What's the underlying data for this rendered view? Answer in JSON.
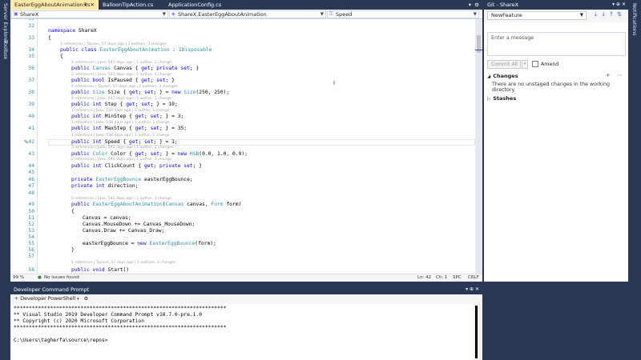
{
  "left_sidebar": [
    "Server Explorer",
    "Toolbox"
  ],
  "right_sidebar": [
    "Notifications"
  ],
  "tabs": [
    {
      "label": "EasterEggAboutAnimation.cs",
      "active": true
    },
    {
      "label": "BalloonTipAction.cs",
      "active": false
    },
    {
      "label": "ApplicationConfig.cs",
      "active": false
    }
  ],
  "navbar": {
    "project": "ShareX",
    "type": "ShareX.EasterEggAboutAnimation",
    "member": "Speed"
  },
  "code_lines": [
    {
      "num": "32",
      "text": ""
    },
    {
      "num": "33",
      "text": "{"
    },
    {
      "num": "34",
      "text": "    public class EasterEggAboutAnimation : IDisposable"
    },
    {
      "num": "35",
      "text": "    {"
    },
    {
      "num": "36",
      "text": "        public Canvas Canvas { get; private set; }"
    },
    {
      "num": "37",
      "text": "        public bool IsPaused { get; set; }"
    },
    {
      "num": "38",
      "text": "        public Size Size { get; set; } = new Size(250, 250);"
    },
    {
      "num": "39",
      "text": "        public int Step { get; set; } = 10;"
    },
    {
      "num": "40",
      "text": "        public int MinStep { get; set; } = 3;"
    },
    {
      "num": "41",
      "text": "        public int MaxStep { get; set; } = 35;"
    },
    {
      "num": "42",
      "text": "        public int Speed { get; set; } = 1;"
    },
    {
      "num": "43",
      "text": "        public Color Color { get; set; } = new HSB(0.0, 1.0, 0.9);"
    },
    {
      "num": "44",
      "text": "        public int ClickCount { get; private set; }"
    },
    {
      "num": "45",
      "text": ""
    },
    {
      "num": "46",
      "text": "        private EasterEggBounce easterEggBounce;"
    },
    {
      "num": "47",
      "text": "        private int direction;"
    },
    {
      "num": "48",
      "text": ""
    },
    {
      "num": "49",
      "text": "        public EasterEggAboutAnimation(Canvas canvas, Form form)"
    },
    {
      "num": "50",
      "text": "        {"
    },
    {
      "num": "51",
      "text": "            Canvas = canvas;"
    },
    {
      "num": "52",
      "text": "            Canvas.MouseDown += Canvas_MouseDown;"
    },
    {
      "num": "53",
      "text": "            Canvas.Draw += Canvas_Draw;"
    },
    {
      "num": "54",
      "text": ""
    },
    {
      "num": "55",
      "text": "            easterEggBounce = new EasterEggBounce(form);"
    },
    {
      "num": "56",
      "text": "        }"
    },
    {
      "num": "57",
      "text": ""
    },
    {
      "num": "58",
      "text": "        public void Start()"
    }
  ],
  "namespace_line": {
    "num": "31",
    "text": "namespace ShareX"
  },
  "codelens": {
    "ns_class": "3 references | Tayson, 57 days ago | 2 authors, 3 changes",
    "canvas": "4 references | Jaex, 541 days ago | 1 author, 1 change",
    "ispaused": "2 references | Jaex, 541 days ago | 1 author, 1 change",
    "size": "4 references | Tayson, 57 days ago | 2 authors, 3 changes",
    "step": "4 references | Jaex, 541 days ago | 1 author, 1 change",
    "minstep": "1 reference | Jaex, 538 days ago | 1 author, 1 change",
    "maxstep": "1 reference | Jaex, 538 days ago | 1 author, 1 change",
    "speed": "1 reference | Jaex, 538 days ago | 1 author, 1 change",
    "color": "3 references | Jaex, 541 days ago | 1 author, 2 changes",
    "clickcount": "2 references | Jaex, 541 days ago | 1 author, 1 change",
    "ctor": "0 references | Jaex, 541 days ago | 1 author, 3 change",
    "start": "1 reference | Tayson, 57 days ago | 2 authors, 3 changes"
  },
  "status": {
    "zoom": "99 %",
    "issues": "No issues found",
    "line": "Ln: 42",
    "col": "Ch: 1",
    "spc": "SPC",
    "eol": "CRLF"
  },
  "git": {
    "title": "Git - ShareX",
    "branch": "NewFeature",
    "message_placeholder": "Enter a message",
    "commit_label": "Commit All",
    "amend_label": "Amend",
    "changes_label": "Changes",
    "no_changes": "There are no unstaged changes in the working directory.",
    "stashes_label": "Stashes"
  },
  "dev": {
    "title": "Developer Command Prompt",
    "shell": "Developer PowerShell",
    "lines": [
      "**********************************************************************",
      "** Visual Studio 2019 Developer Command Prompt v16.7.0-pre.1.0",
      "** Copyright (c) 2020 Microsoft Corporation",
      "**********************************************************************",
      "",
      "C:\\Users\\tagherfa\\source\\repos>"
    ]
  }
}
